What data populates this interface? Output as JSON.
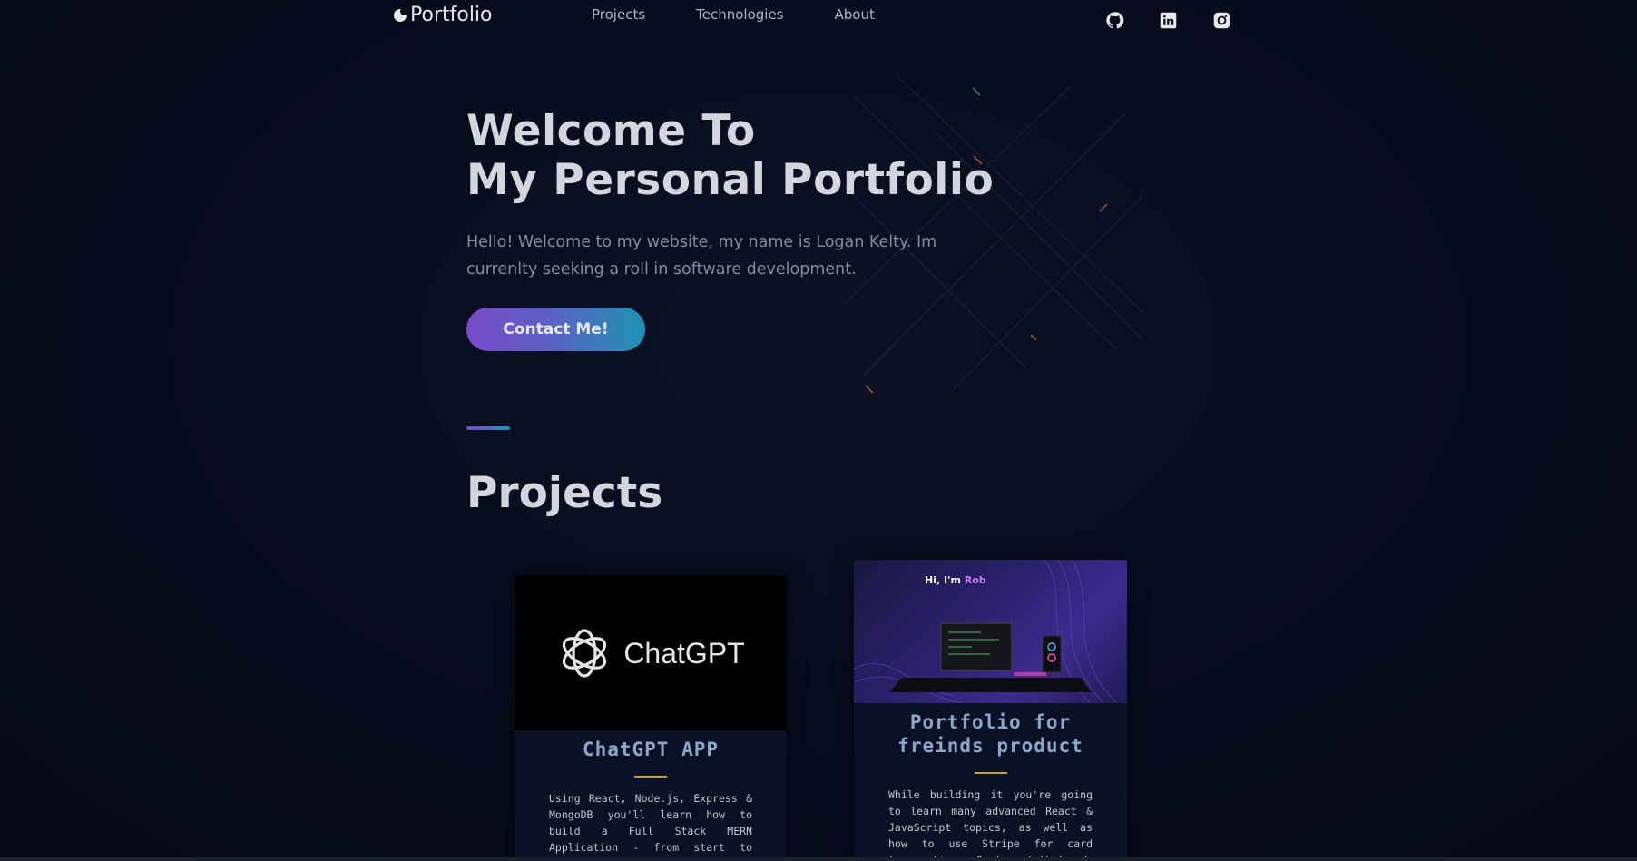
{
  "nav": {
    "logo_text": "Portfolio",
    "links": [
      {
        "label": "Projects"
      },
      {
        "label": "Technologies"
      },
      {
        "label": "About"
      }
    ],
    "socials": [
      {
        "icon": "github-icon"
      },
      {
        "icon": "linkedin-icon"
      },
      {
        "icon": "instagram-icon"
      }
    ]
  },
  "hero": {
    "title_line1": "Welcome To",
    "title_line2": "My Personal Portfolio",
    "subtitle": "Hello! Welcome to my website, my name is Logan Kelty. Im currenlty seeking a roll in software development.",
    "cta_label": "Contact Me!"
  },
  "projects": {
    "section_title": "Projects",
    "cards": [
      {
        "image_text": "ChatGPT",
        "title": "ChatGPT APP",
        "description": "Using React, Node.js, Express & MongoDB you'll learn how to build a Full Stack MERN Application - from start to finish. The App is called"
      },
      {
        "image_greeting_prefix": "Hi, I'm ",
        "image_greeting_name": "Rob",
        "title": "Portfolio for freinds product",
        "description": "While building it you're going to learn many advanced React & JavaScript topics, as well as how to use Stripe for card transactions. On top of that, at"
      }
    ]
  },
  "colors": {
    "background": "#070c1c",
    "accent_start": "#7a4bc9",
    "accent_end": "#1e93b5",
    "card_title": "#8aa8cc",
    "card_rule": "#c9a227"
  }
}
